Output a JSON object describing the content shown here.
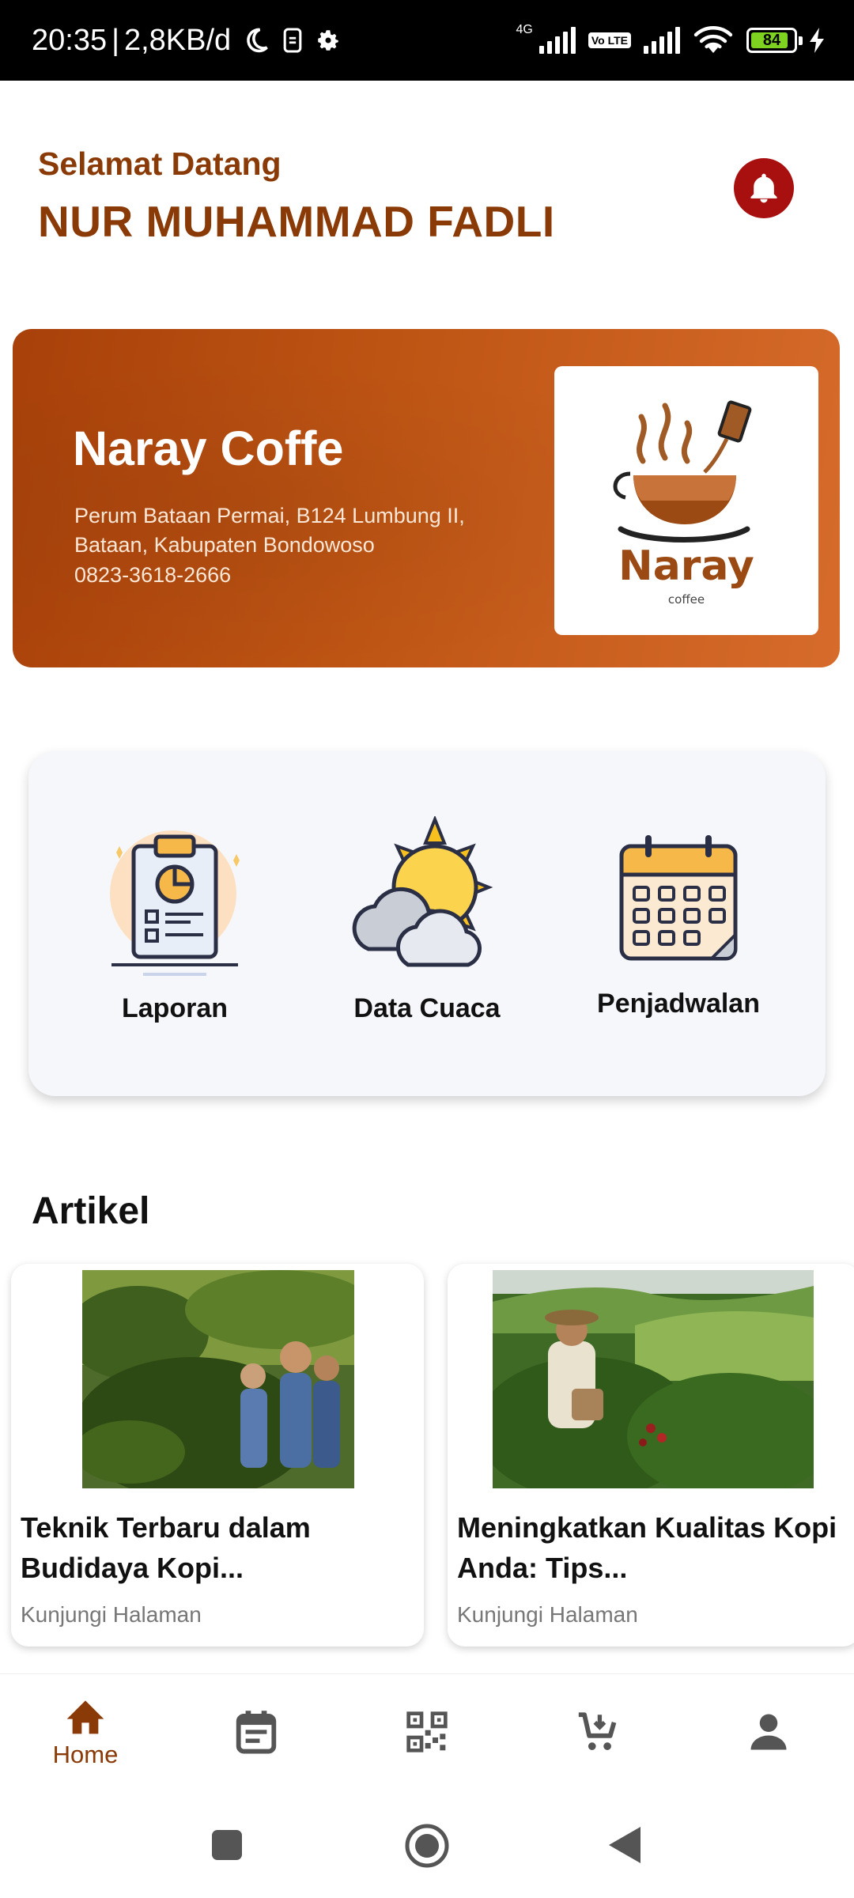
{
  "status_bar": {
    "time": "20:35",
    "separator": "|",
    "speed": "2,8KB/d",
    "network_label": "4G",
    "volte_label": "Vo LTE",
    "battery": "84"
  },
  "header": {
    "greeting": "Selamat Datang",
    "user_name": "NUR MUHAMMAD FADLI"
  },
  "banner": {
    "name": "Naray Coffe",
    "address": "Perum Bataan Permai, B124 Lumbung II, Bataan, Kabupaten Bondowoso",
    "phone": "0823-3618-2666",
    "logo_text": "Naray",
    "logo_subtext": "coffee"
  },
  "menu": {
    "items": [
      {
        "label": "Laporan",
        "icon": "report-clipboard-icon"
      },
      {
        "label": "Data Cuaca",
        "icon": "weather-sun-cloud-icon"
      },
      {
        "label": "Penjadwalan",
        "icon": "calendar-icon"
      }
    ]
  },
  "articles": {
    "title": "Artikel",
    "items": [
      {
        "title": "Teknik Terbaru dalam Budidaya Kopi...",
        "link": "Kunjungi Halaman"
      },
      {
        "title": "Meningkatkan Kualitas Kopi Anda: Tips...",
        "link": "Kunjungi Halaman"
      }
    ]
  },
  "bottom_nav": {
    "items": [
      {
        "label": "Home",
        "icon": "home-icon",
        "active": true
      },
      {
        "label": "",
        "icon": "schedule-list-icon",
        "active": false
      },
      {
        "label": "",
        "icon": "qr-code-icon",
        "active": false
      },
      {
        "label": "",
        "icon": "cart-icon",
        "active": false
      },
      {
        "label": "",
        "icon": "profile-icon",
        "active": false
      }
    ]
  },
  "colors": {
    "primary": "#8a3a06",
    "banner_start": "#a8410a",
    "banner_end": "#d66b2b",
    "bell_bg": "#a80f0f",
    "nav_inactive": "#555555"
  }
}
